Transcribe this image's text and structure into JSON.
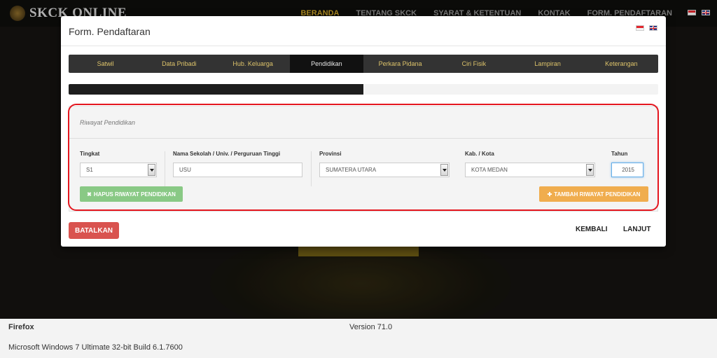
{
  "background": {
    "logo_text": "SKCK ONLINE",
    "menu": [
      "BERANDA",
      "TENTANG SKCK",
      "SYARAT & KETENTUAN",
      "KONTAK",
      "FORM. PENDAFTARAN"
    ],
    "active_menu": "BERANDA"
  },
  "modal": {
    "title": "Form. Pendaftaran",
    "steps": [
      "Satwil",
      "Data Pribadi",
      "Hub. Keluarga",
      "Pendidikan",
      "Perkara Pidana",
      "Ciri Fisik",
      "Lampiran",
      "Keterangan"
    ],
    "active_step": "Pendidikan",
    "progress_fraction": 0.5,
    "panel": {
      "title": "Riwayat Pendidikan",
      "fields": {
        "tingkat": {
          "label": "Tingkat",
          "value": "S1"
        },
        "sekolah": {
          "label": "Nama Sekolah / Univ. / Perguruan Tinggi",
          "value": "USU"
        },
        "provinsi": {
          "label": "Provinsi",
          "value": "SUMATERA UTARA"
        },
        "kota": {
          "label": "Kab. / Kota",
          "value": "KOTA MEDAN"
        },
        "tahun": {
          "label": "Tahun",
          "value": "2015"
        }
      },
      "remove_button": "HAPUS RIWAYAT PENDIDIKAN",
      "add_button": "TAMBAH RIWAYAT PENDIDIKAN"
    },
    "cancel_button": "BATALKAN",
    "back_button": "KEMBALI",
    "next_button": "LANJUT"
  },
  "footer": {
    "browser": "Firefox",
    "version": "Version 71.0",
    "os": "Microsoft Windows 7 Ultimate  32-bit Build 6.1.7600"
  },
  "colors": {
    "accent_gold": "#ddc36a",
    "danger": "#d9534f",
    "success_light": "#89c985",
    "warning": "#f0ad4e",
    "highlight": "#e4161f"
  }
}
